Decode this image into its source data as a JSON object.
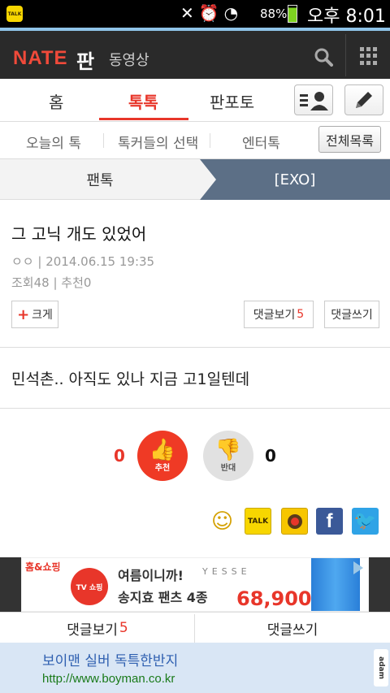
{
  "status_bar": {
    "talk_label": "TALK",
    "battery": "88%",
    "time": "오후 8:01"
  },
  "header": {
    "logo": "NATE",
    "logo_suffix": "판",
    "sub": "동영상"
  },
  "main_tabs": [
    {
      "label": "홈",
      "active": false
    },
    {
      "label": "톡톡",
      "active": true
    },
    {
      "label": "판포토",
      "active": false
    }
  ],
  "sub_tabs": {
    "items": [
      "오늘의 톡",
      "톡커들의 선택",
      "엔터톡"
    ],
    "all_button": "전체목록"
  },
  "breadcrumb": {
    "parent": "팬톡",
    "current": "[EXO]"
  },
  "article": {
    "title": "그 고닉 개도 있었어",
    "author": "ㅇㅇ",
    "date": "2014.06.15 19:35",
    "views": "조회48",
    "recommends": "추천0",
    "enlarge_label": "크게",
    "view_comments_label": "댓글보기",
    "comment_count": "5",
    "write_comment_label": "댓글쓰기",
    "body": "민석촌.. 아직도 있나 지금 고1일텐데"
  },
  "votes": {
    "up_count": "0",
    "up_label": "추천",
    "down_count": "0",
    "down_label": "반대"
  },
  "share_icons": [
    "emoticon-icon",
    "kakaotalk-icon",
    "kakaostory-icon",
    "facebook-icon",
    "twitter-icon"
  ],
  "ad": {
    "brand": "홈&쇼핑",
    "tv_label": "TV 쇼핑",
    "line1": "여름이니까!",
    "yesse": "YESSE",
    "line2": "송지효 팬츠 4종",
    "price": "68,900원!"
  },
  "bottom_buttons": {
    "view_comments": "댓글보기",
    "count": "5",
    "write_comment": "댓글쓰기"
  },
  "text_ad": {
    "title": "보이맨 실버 독특한반지",
    "url": "http://www.boyman.co.kr",
    "badge": "adam"
  },
  "colors": {
    "accent": "#e8362a",
    "header_bg": "#2a2a2a",
    "crumb_active": "#5c6f86"
  }
}
